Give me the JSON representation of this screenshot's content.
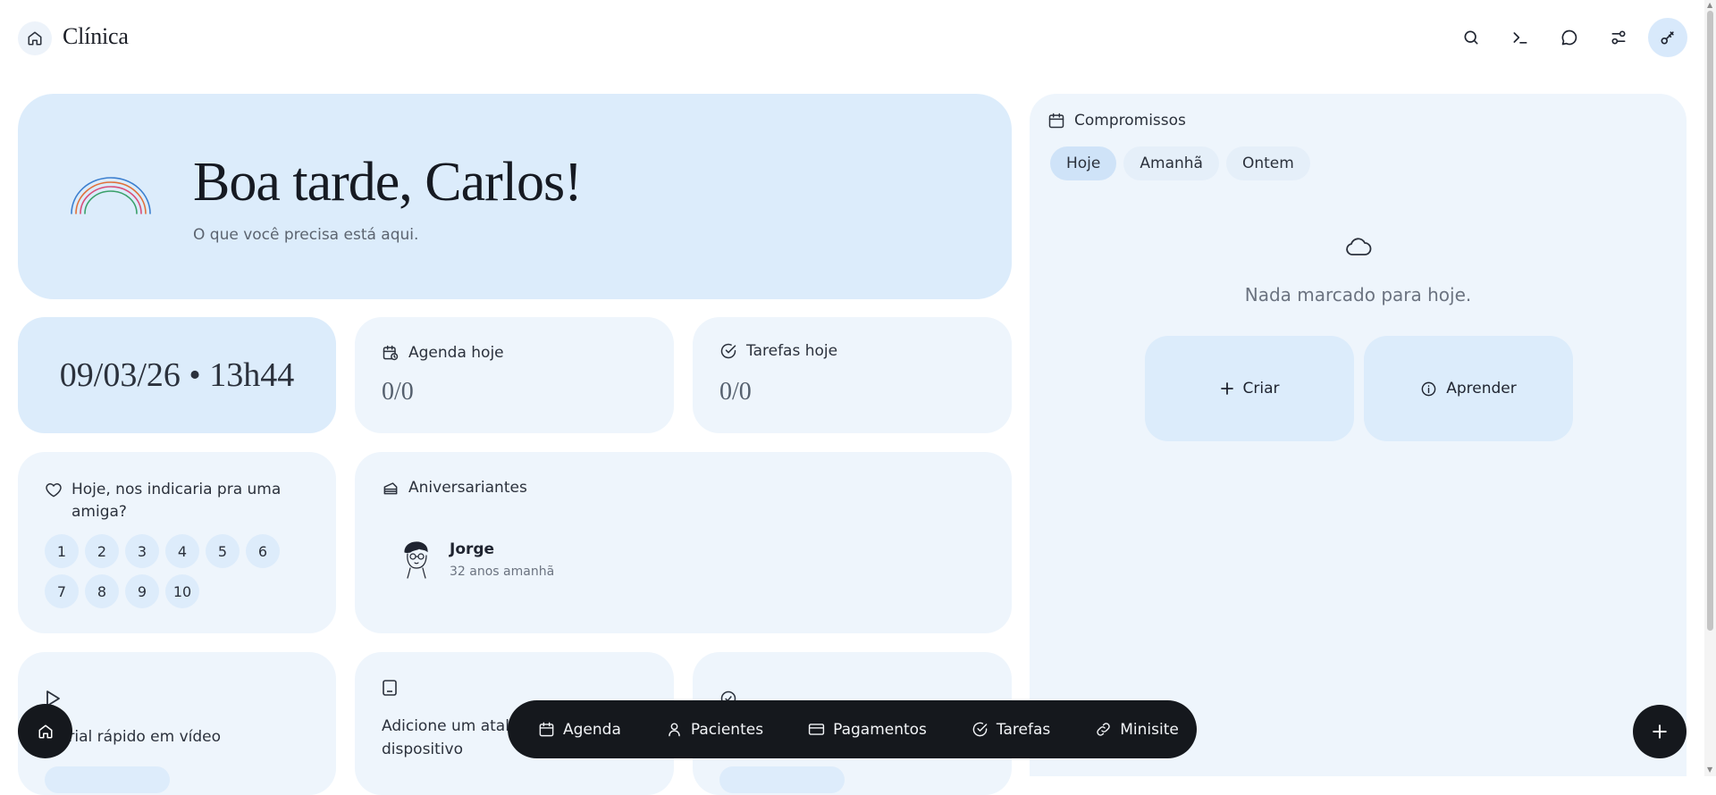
{
  "header": {
    "brand": "Clínica",
    "icons": [
      "search-icon",
      "terminal-icon",
      "chat-icon",
      "settings-sliders-icon",
      "key-icon"
    ]
  },
  "hero": {
    "greeting": "Boa tarde, Carlos!",
    "subtitle": "O que você precisa está aqui."
  },
  "datetime": "09/03/26 • 13h44",
  "agenda_today": {
    "label": "Agenda hoje",
    "value": "0/0"
  },
  "tasks_today": {
    "label": "Tarefas hoje",
    "value": "0/0"
  },
  "nps": {
    "question": "Hoje, nos indicaria pra uma amiga?",
    "options": [
      "1",
      "2",
      "3",
      "4",
      "5",
      "6",
      "7",
      "8",
      "9",
      "10"
    ]
  },
  "birthdays": {
    "title": "Aniversariantes",
    "people": [
      {
        "name": "Jorge",
        "detail": "32 anos amanhã"
      }
    ]
  },
  "appointments": {
    "title": "Compromissos",
    "tabs": [
      "Hoje",
      "Amanhã",
      "Ontem"
    ],
    "active_tab": "Hoje",
    "empty": "Nada marcado para hoje.",
    "create": "Criar",
    "learn": "Aprender"
  },
  "bottom_cards": {
    "video": "orial rápido em vídeo",
    "shortcut": "Adicione um atalh",
    "shortcut_line2": "dispositivo"
  },
  "dock": {
    "items": [
      {
        "label": "Agenda",
        "icon": "calendar-icon"
      },
      {
        "label": "Pacientes",
        "icon": "user-icon"
      },
      {
        "label": "Pagamentos",
        "icon": "credit-card-icon"
      },
      {
        "label": "Tarefas",
        "icon": "check-circle-icon"
      },
      {
        "label": "Minisite",
        "icon": "link-icon"
      }
    ]
  },
  "colors": {
    "hero_bg": "#dcecfb",
    "card_bg": "#eef5fc",
    "dock_bg": "#15181d",
    "active_tab": "#cfe3f8"
  }
}
